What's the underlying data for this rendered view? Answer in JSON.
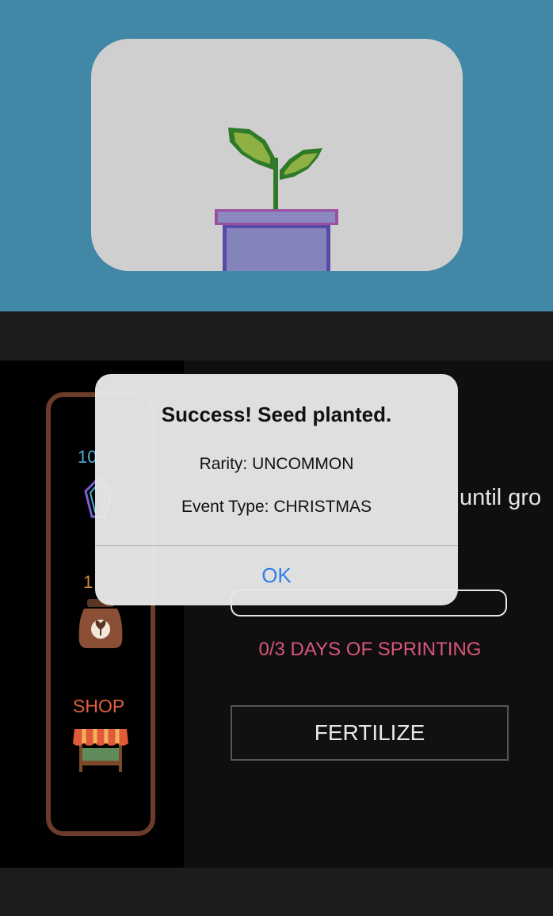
{
  "colors": {
    "sky": "#4188a6",
    "card": "#cfcfcf",
    "frame_brown": "#6b3c2a",
    "gem_count": "#4ab0d8",
    "seed_count": "#d08a3a",
    "shop": "#e0603c",
    "sprint": "#d9557a",
    "link_blue": "#2f7fe6"
  },
  "icons": {
    "gem": "gem-icon",
    "seed_bag": "seed-bag-icon",
    "shop": "shop-stall-icon",
    "plant": "potted-sprout-icon"
  },
  "sidebar": {
    "gems_count": "10",
    "seeds_count": "1",
    "shop_label": "SHOP"
  },
  "main": {
    "growth_text": "until gro",
    "sprint_status": "0/3 DAYS OF SPRINTING",
    "fertilize_label": "FERTILIZE"
  },
  "dialog": {
    "title": "Success! Seed planted.",
    "rarity_line": "Rarity: UNCOMMON",
    "event_line": "Event Type: CHRISTMAS",
    "ok_label": "OK"
  }
}
